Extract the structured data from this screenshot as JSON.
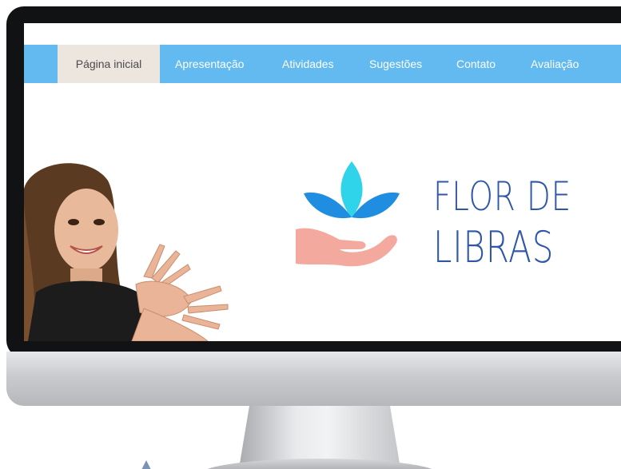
{
  "nav": {
    "items": [
      {
        "label": "Página inicial",
        "active": true
      },
      {
        "label": "Apresentação",
        "active": false
      },
      {
        "label": "Atividades",
        "active": false
      },
      {
        "label": "Sugestões",
        "active": false
      },
      {
        "label": "Contato",
        "active": false
      },
      {
        "label": "Avaliação",
        "active": false
      }
    ]
  },
  "hero": {
    "logo_line1": "FLOR DE",
    "logo_line2": "LIBRAS"
  },
  "colors": {
    "nav_background": "#62baf0",
    "nav_active_background": "#ece6de",
    "logo_text": "#2f57a8",
    "petal_dark": "#1f8ee0",
    "petal_light": "#2fd3ea",
    "hand": "#f4a99f"
  }
}
